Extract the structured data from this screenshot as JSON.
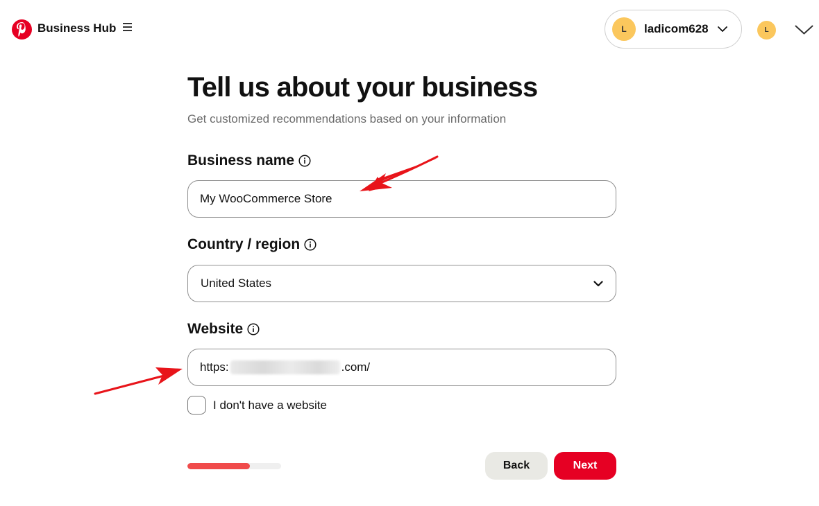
{
  "header": {
    "brand": "Business Hub",
    "account_name": "ladicom628",
    "avatar_initial": "L"
  },
  "page": {
    "title": "Tell us about your business",
    "subtitle": "Get customized recommendations based on your information"
  },
  "form": {
    "business_name": {
      "label": "Business name",
      "value": "My WooCommerce Store"
    },
    "country": {
      "label": "Country / region",
      "value": "United States"
    },
    "website": {
      "label": "Website",
      "prefix": "https:",
      "suffix": ".com/"
    },
    "no_website": {
      "label": "I don't have a website",
      "checked": false
    }
  },
  "progress": {
    "fraction": 0.67
  },
  "buttons": {
    "back": "Back",
    "next": "Next"
  },
  "colors": {
    "brand": "#e60023",
    "progress": "#f04b4b",
    "avatar": "#fbc75d",
    "annotation_arrow": "#e8141a"
  }
}
